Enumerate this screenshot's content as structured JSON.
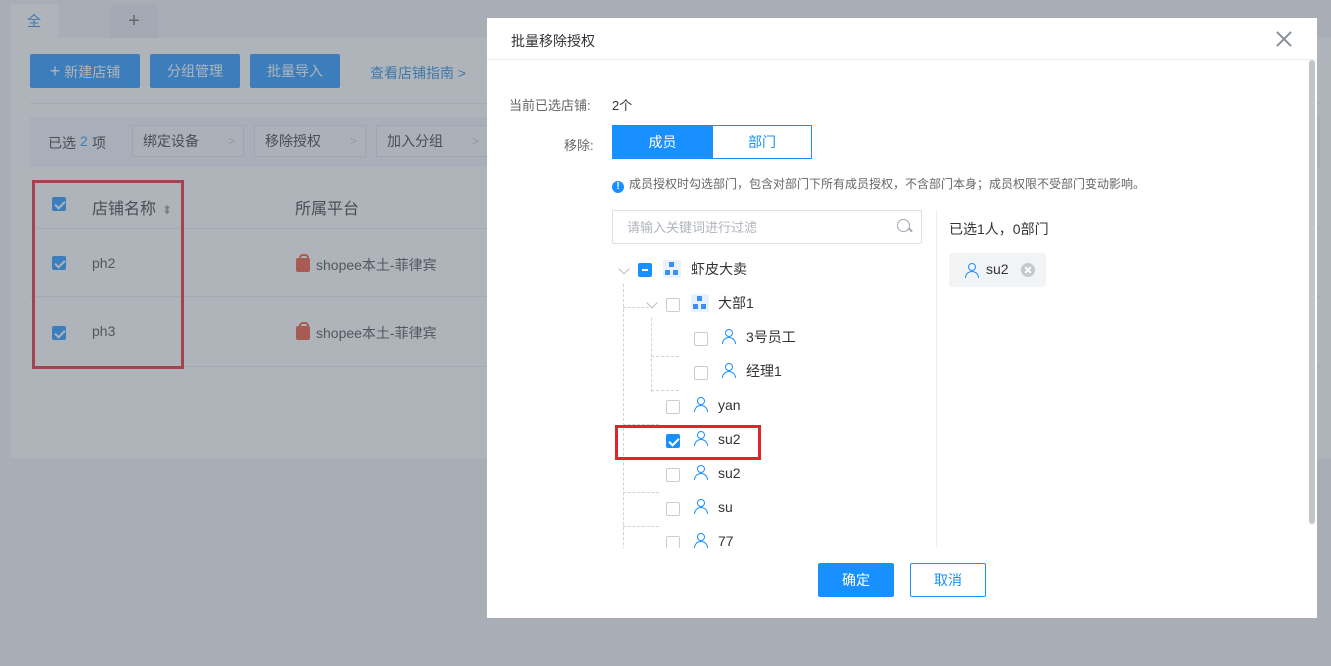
{
  "page": {
    "tabs": [
      {
        "label": "全部店铺"
      },
      {
        "label": "+"
      }
    ],
    "toolbar": {
      "new_store": "新建店铺",
      "group_manage": "分组管理",
      "batch_import": "批量导入",
      "guide_link": "查看店铺指南 >"
    },
    "selection_bar": {
      "prefix": "已选",
      "count": "2",
      "suffix": "项",
      "actions": [
        {
          "label": "绑定设备"
        },
        {
          "label": "移除授权"
        },
        {
          "label": "加入分组"
        }
      ]
    },
    "table": {
      "headers": {
        "name": "店铺名称",
        "platform": "所属平台"
      },
      "rows": [
        {
          "name": "ph2",
          "platform": "shopee本土-菲律宾",
          "checked": true
        },
        {
          "name": "ph3",
          "platform": "shopee本土-菲律宾",
          "checked": true
        }
      ]
    }
  },
  "modal": {
    "title": "批量移除授权",
    "selected_label": "当前已选店铺:",
    "selected_value": "2个",
    "remove_label": "移除:",
    "segments": [
      {
        "label": "成员",
        "active": true
      },
      {
        "label": "部门",
        "active": false
      }
    ],
    "hint": "成员授权时勾选部门，包含对部门下所有成员授权，不含部门本身；成员权限不受部门变动影响。",
    "search_placeholder": "请输入关键词进行过滤",
    "tree": [
      {
        "label": "虾皮大卖",
        "type": "org",
        "state": "partial"
      },
      {
        "label": "大部1",
        "type": "org",
        "state": "unchecked"
      },
      {
        "label": "3号员工",
        "type": "user",
        "state": "unchecked"
      },
      {
        "label": "经理1",
        "type": "user",
        "state": "unchecked"
      },
      {
        "label": "yan",
        "type": "user",
        "state": "unchecked"
      },
      {
        "label": "su2",
        "type": "user",
        "state": "checked"
      },
      {
        "label": "su2",
        "type": "user",
        "state": "unchecked"
      },
      {
        "label": "su",
        "type": "user",
        "state": "unchecked"
      },
      {
        "label": "77",
        "type": "user",
        "state": "unchecked"
      }
    ],
    "right_title": "已选1人，0部门",
    "selected_chip": "su2",
    "confirm": "确定",
    "cancel": "取消"
  },
  "colors": {
    "primary": "#1890ff",
    "highlight": "#e7212a",
    "platform": "#ee4d2d"
  }
}
